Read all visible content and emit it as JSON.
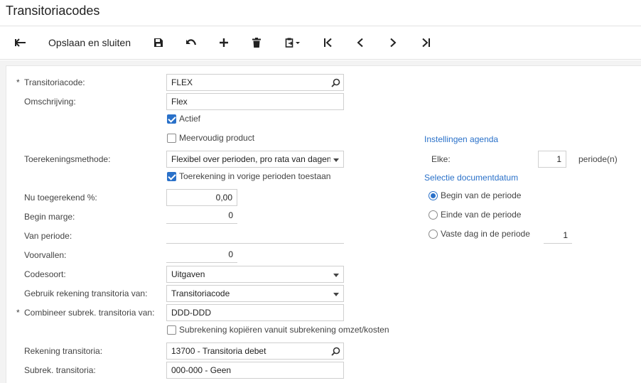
{
  "page": {
    "title": "Transitoriacodes"
  },
  "toolbar": {
    "save_close_label": "Opslaan en sluiten",
    "icons": [
      "back-arrow-icon",
      "save-icon",
      "undo-icon",
      "add-icon",
      "delete-icon",
      "clipboard-icon",
      "first-record-icon",
      "previous-record-icon",
      "next-record-icon",
      "last-record-icon"
    ]
  },
  "form": {
    "transitoriacode": {
      "label": "Transitoriacode:",
      "value": "FLEX",
      "required_mark": "*"
    },
    "omschrijving": {
      "label": "Omschrijving:",
      "value": "Flex"
    },
    "actief": {
      "label": "Actief",
      "checked": true
    },
    "meervoudig": {
      "label": "Meervoudig product",
      "checked": false
    },
    "toerekeningsmethode": {
      "label": "Toerekeningsmethode:",
      "value": "Flexibel over perioden, pro rata van dagen"
    },
    "toerekening_vorige": {
      "label": "Toerekening in vorige perioden toestaan",
      "checked": true
    },
    "nu_toegerekend": {
      "label": "Nu toegerekend %:",
      "value": "0,00"
    },
    "begin_marge": {
      "label": "Begin marge:",
      "value": "0"
    },
    "van_periode": {
      "label": "Van periode:",
      "value": ""
    },
    "voorvallen": {
      "label": "Voorvallen:",
      "value": "0"
    },
    "codesoort": {
      "label": "Codesoort:",
      "value": "Uitgaven"
    },
    "gebruik_rekening": {
      "label": "Gebruik rekening transitoria van:",
      "value": "Transitoriacode"
    },
    "combineer_subrek": {
      "label": "Combineer subrek. transitoria van:",
      "value": "DDD-DDD",
      "required_mark": "*"
    },
    "subrek_kopieren": {
      "label": "Subrekening kopiëren vanuit subrekening omzet/kosten",
      "checked": false
    },
    "rekening_transitoria": {
      "label": "Rekening transitoria:",
      "value": "13700 - Transitoria debet"
    },
    "subrek_transitoria": {
      "label": "Subrek. transitoria:",
      "value": "000-000 - Geen"
    }
  },
  "agenda": {
    "header": "Instellingen agenda",
    "elke_label": "Elke:",
    "elke_value": "1",
    "elke_unit": "periode(n)"
  },
  "docdatum": {
    "header": "Selectie documentdatum",
    "options": [
      {
        "label": "Begin van de periode",
        "selected": true
      },
      {
        "label": "Einde van de periode",
        "selected": false
      },
      {
        "label": "Vaste dag in de periode",
        "selected": false
      }
    ],
    "vaste_dag_value": "1"
  },
  "colors": {
    "accent": "#2a71c9",
    "border": "#cfcfcf",
    "background": "#f3f3f3"
  }
}
